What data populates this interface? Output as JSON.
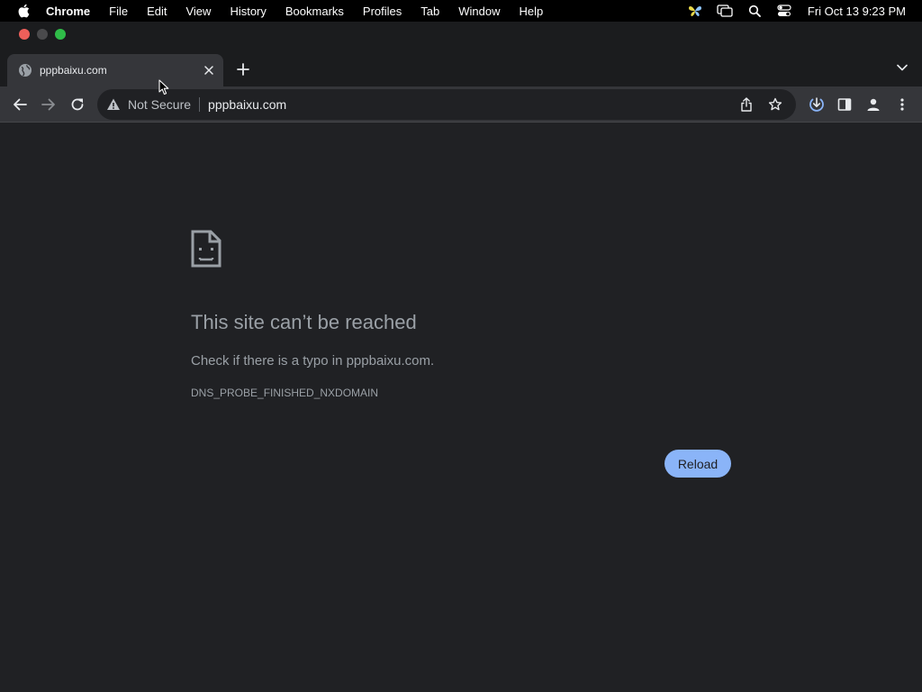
{
  "menubar": {
    "items": [
      "Chrome",
      "File",
      "Edit",
      "View",
      "History",
      "Bookmarks",
      "Profiles",
      "Tab",
      "Window",
      "Help"
    ],
    "clock": "Fri Oct 13  9:23 PM",
    "status_icons": [
      "vpn-butterfly-icon",
      "screen-mirroring-icon",
      "spotlight-search-icon",
      "control-center-icon"
    ]
  },
  "tab": {
    "title": "pppbaixu.com",
    "favicon": "globe-icon"
  },
  "omnibox": {
    "security_label": "Not Secure",
    "url": "pppbaixu.com"
  },
  "error": {
    "title": "This site can’t be reached",
    "body": "Check if there is a typo in pppbaixu.com.",
    "code": "DNS_PROBE_FINISHED_NXDOMAIN",
    "reload_label": "Reload"
  },
  "colors": {
    "page_bg": "#202124",
    "accent": "#8ab4f8",
    "traffic_close": "#ec5f5a",
    "traffic_max": "#2fbc48"
  }
}
